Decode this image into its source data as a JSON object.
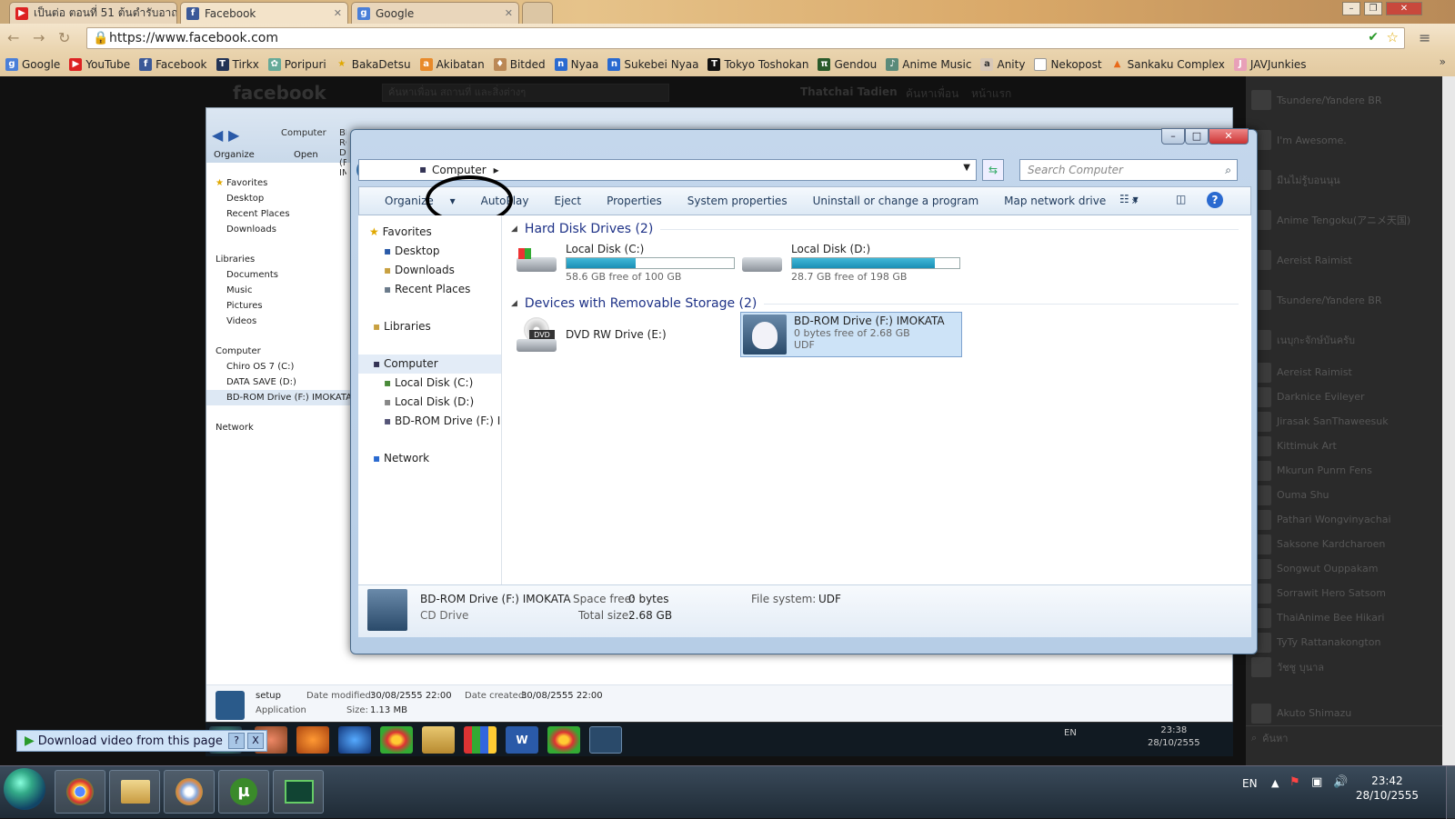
{
  "browser": {
    "tabs": [
      {
        "title": "เป็นต่อ ตอนที่ 51 ต้นตำรับอาถ"
      },
      {
        "title": "Facebook"
      },
      {
        "title": "Google"
      }
    ],
    "url": "https://www.facebook.com",
    "bookmarks": [
      "Google",
      "YouTube",
      "Facebook",
      "Tirkx",
      "Poripuri",
      "BakaDetsu",
      "Akibatan",
      "Bitded",
      "Nyaa",
      "Sukebei Nyaa",
      "Tokyo Toshokan",
      "Gendou",
      "Anime Music",
      "Anity",
      "Nekopost",
      "Sankaku Complex",
      "JAVJunkies"
    ]
  },
  "facebook": {
    "logo": "facebook",
    "search_placeholder": "ค้นหาเพื่อน สถานที่ และสิ่งต่างๆ",
    "user": "Thatchai Tadien",
    "find_friends": "ค้นหาเพื่อน",
    "home": "หน้าแรก",
    "feed": [
      "Tsundere/Yandere BR",
      "I'm Awesome.",
      "มีนไม่รู้บอนนุน",
      "Anime Tengoku(アニメ天国)",
      "Aereist Raimist",
      "Tsundere/Yandere BR",
      "เนบุกะจักษ์บันครับ"
    ],
    "chat": [
      "Aereist Raimist",
      "Darknice Evileyer",
      "Jirasak SanThaweesuk",
      "Kittimuk Art",
      "Mkurun Punrn Fens",
      "Ouma Shu",
      "Pathari Wongvinyachai",
      "Saksone Kardcharoen",
      "Songwut Ouppakam",
      "Sorrawit Hero Satsom",
      "ThaiAnime Bee Hikari",
      "TyTy Rattanakongton",
      "วัชชู บุนาล",
      "Akuto Shimazu"
    ],
    "chat_search": "ค้นหา"
  },
  "back_window": {
    "address": [
      "Computer",
      "BD-ROM Drive (F:) IMOKATA"
    ],
    "organize": "Organize",
    "open": "Open",
    "tree": [
      "Favorites",
      "Desktop",
      "Recent Places",
      "Downloads",
      "Libraries",
      "Documents",
      "Music",
      "Pictures",
      "Videos",
      "Computer",
      "Chiro OS 7 (C:)",
      "DATA SAVE (D:)",
      "BD-ROM Drive (F:) IMOKATA",
      "Network"
    ],
    "details": {
      "name": "setup",
      "type": "Application",
      "modified_label": "Date modified:",
      "modified": "30/08/2555 22:00",
      "created_label": "Date created:",
      "created": "30/08/2555 22:00",
      "size_label": "Size:",
      "size": "1.13 MB"
    },
    "tray": {
      "lang": "EN",
      "time": "23:38",
      "date": "28/10/2555"
    }
  },
  "front_window": {
    "address_root": "Computer",
    "search_placeholder": "Search Computer",
    "commands": [
      "Organize",
      "AutoPlay",
      "Eject",
      "Properties",
      "System properties",
      "Uninstall or change a program",
      "Map network drive",
      "»"
    ],
    "nav": {
      "favorites": "Favorites",
      "desktop": "Desktop",
      "downloads": "Downloads",
      "recent": "Recent Places",
      "libraries": "Libraries",
      "computer": "Computer",
      "c": "Local Disk (C:)",
      "d": "Local Disk (D:)",
      "f": "BD-ROM Drive (F:) IMOKATA",
      "network": "Network"
    },
    "groups": {
      "hdd": "Hard Disk Drives (2)",
      "removable": "Devices with Removable Storage (2)"
    },
    "drives": [
      {
        "name": "Local Disk (C:)",
        "free": "58.6 GB free of 100 GB",
        "used_fraction": 0.414
      },
      {
        "name": "Local Disk (D:)",
        "free": "28.7 GB free of 198 GB",
        "used_fraction": 0.855
      },
      {
        "name": "DVD RW Drive (E:)",
        "label": "DVD"
      },
      {
        "name": "BD-ROM Drive (F:) IMOKATA",
        "free": "0 bytes free of 2.68 GB",
        "fs": "UDF"
      }
    ],
    "details": {
      "name": "BD-ROM Drive (F:) IMOKATA",
      "type": "CD Drive",
      "space_free_label": "Space free:",
      "space_free": "0 bytes",
      "total_label": "Total size:",
      "total": "2.68 GB",
      "fs_label": "File system:",
      "fs": "UDF"
    }
  },
  "download_bar": {
    "label": "Download video from this page",
    "help": "?",
    "close": "X"
  },
  "taskbar": {
    "lang": "EN",
    "time": "23:42",
    "date": "28/10/2555"
  }
}
